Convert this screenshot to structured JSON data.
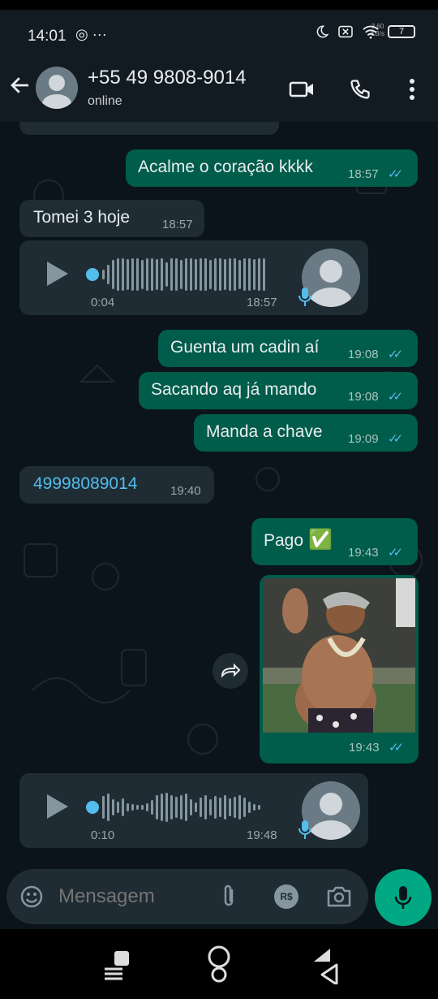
{
  "status_bar": {
    "time": "14:01",
    "left_icons": "◎ ···",
    "net_speed_top": "3,60",
    "net_speed_bottom": "KB/s",
    "battery": "7"
  },
  "header": {
    "back_icon": "arrow-left-icon",
    "contact_name": "+55 49 9808-9014",
    "contact_status": "online",
    "icons": [
      "video-call-icon",
      "voice-call-icon",
      "more-vert-icon"
    ]
  },
  "messages": {
    "m0": {
      "text": "Acalme o coração kkkk",
      "time": "18:57",
      "direction": "out"
    },
    "m1": {
      "text": "Tomei 3 hoje",
      "time": "18:57",
      "direction": "in"
    },
    "m2": {
      "type": "audio",
      "duration": "0:04",
      "time": "18:57",
      "direction": "in"
    },
    "m3": {
      "text": "Guenta um cadin aí",
      "time": "19:08",
      "direction": "out"
    },
    "m4": {
      "text": "Sacando aq já mando",
      "time": "19:08",
      "direction": "out"
    },
    "m5": {
      "text": "Manda a chave",
      "time": "19:09",
      "direction": "out"
    },
    "m6": {
      "text": "49998089014",
      "time": "19:40",
      "direction": "in"
    },
    "m7": {
      "text": "Pago",
      "emoji": "✅",
      "time": "19:43",
      "direction": "out"
    },
    "m8": {
      "type": "image",
      "time": "19:43",
      "direction": "out"
    },
    "m9": {
      "type": "audio",
      "duration": "0:10",
      "time": "19:48",
      "direction": "in"
    }
  },
  "read_ticks": "✓✓",
  "input": {
    "placeholder": "Mensagem",
    "icons": [
      "emoji-icon",
      "attach-icon",
      "payment-icon",
      "camera-icon",
      "mic-icon"
    ],
    "payment_label": "R$"
  },
  "colors": {
    "header_bg": "#111b21",
    "chat_bg": "#0b141a",
    "outgoing_bubble": "#005c4b",
    "incoming_bubble": "#1f2c34",
    "accent": "#00a884",
    "read_tick": "#53bdeb"
  }
}
